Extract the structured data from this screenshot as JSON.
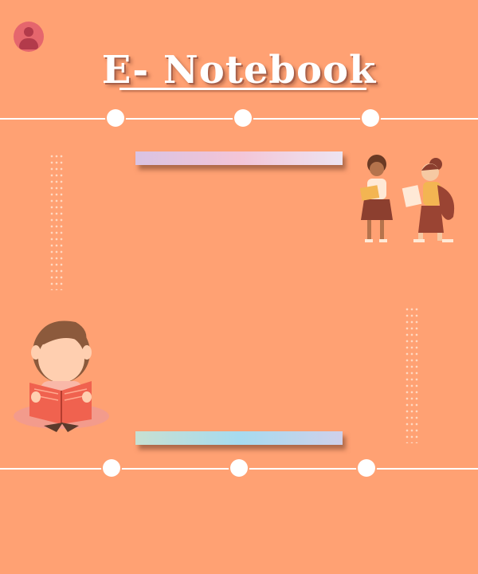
{
  "header": {
    "title": "E- Notebook",
    "avatar_icon": "user-icon"
  },
  "decor": {
    "top_bar_colors": [
      "#d9c3e3",
      "#f3c5d7",
      "#ede4f1"
    ],
    "bottom_bar_colors": [
      "#c7e0d2",
      "#a6dbef",
      "#cfd0ea"
    ],
    "illustrations": [
      "two-students-with-books",
      "child-reading-book"
    ]
  },
  "colors": {
    "background": "#ffa173",
    "accent": "#e5666d"
  }
}
